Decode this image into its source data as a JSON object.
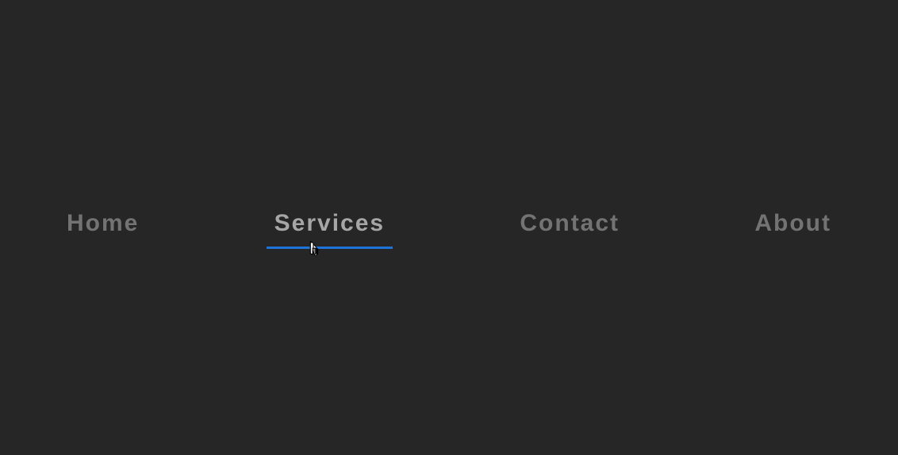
{
  "nav": {
    "items": [
      {
        "label": "Home"
      },
      {
        "label": "Services"
      },
      {
        "label": "Contact"
      },
      {
        "label": "About"
      }
    ]
  },
  "colors": {
    "background": "#262626",
    "text_inactive": "#737373",
    "text_active": "#a6a6a6",
    "underline": "#1e73d9"
  },
  "active_index": 1
}
